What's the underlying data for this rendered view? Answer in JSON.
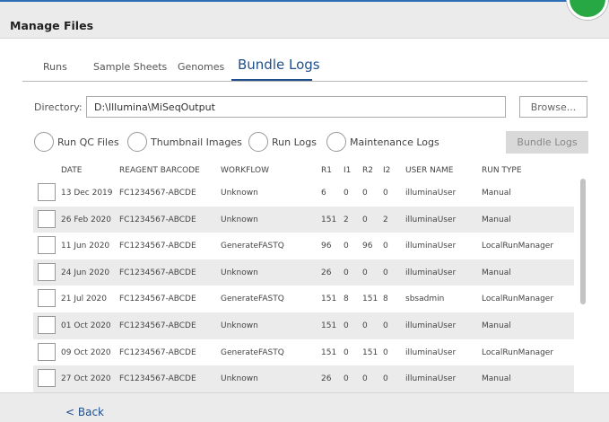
{
  "window": {
    "title": "Manage Files",
    "status_color": "#27a844"
  },
  "tabs": [
    "Runs",
    "Sample Sheets",
    "Genomes",
    "Bundle Logs"
  ],
  "active_tab": "Bundle Logs",
  "directory": {
    "label": "Directory:",
    "value": "D:\\Illumina\\MiSeqOutput",
    "browse_label": "Browse..."
  },
  "log_options": [
    "Run QC Files",
    "Thumbnail Images",
    "Run Logs",
    "Maintenance Logs"
  ],
  "bundle_button_label": "Bundle Logs",
  "table": {
    "columns": [
      "Date",
      "Reagent Barcode",
      "Workflow",
      "R1",
      "I1",
      "R2",
      "I2",
      "User Name",
      "Run Type"
    ],
    "rows": [
      [
        "13 Dec 2019",
        "FC1234567-ABCDE",
        "Unknown",
        "6",
        "0",
        "0",
        "0",
        "illuminaUser",
        "Manual"
      ],
      [
        "26 Feb 2020",
        "FC1234567-ABCDE",
        "Unknown",
        "151",
        "2",
        "0",
        "2",
        "illuminaUser",
        "Manual"
      ],
      [
        "11 Jun 2020",
        "FC1234567-ABCDE",
        "GenerateFASTQ",
        "96",
        "0",
        "96",
        "0",
        "illuminaUser",
        "LocalRunManager"
      ],
      [
        "24 Jun 2020",
        "FC1234567-ABCDE",
        "Unknown",
        "26",
        "0",
        "0",
        "0",
        "illuminaUser",
        "Manual"
      ],
      [
        "21 Jul 2020",
        "FC1234567-ABCDE",
        "GenerateFASTQ",
        "151",
        "8",
        "151",
        "8",
        "sbsadmin",
        "LocalRunManager"
      ],
      [
        "01 Oct 2020",
        "FC1234567-ABCDE",
        "Unknown",
        "151",
        "0",
        "0",
        "0",
        "illuminaUser",
        "Manual"
      ],
      [
        "09 Oct 2020",
        "FC1234567-ABCDE",
        "GenerateFASTQ",
        "151",
        "0",
        "151",
        "0",
        "illuminaUser",
        "LocalRunManager"
      ],
      [
        "27 Oct 2020",
        "FC1234567-ABCDE",
        "Unknown",
        "26",
        "0",
        "0",
        "0",
        "illuminaUser",
        "Manual"
      ]
    ]
  },
  "footer": {
    "back_label": "< Back"
  }
}
